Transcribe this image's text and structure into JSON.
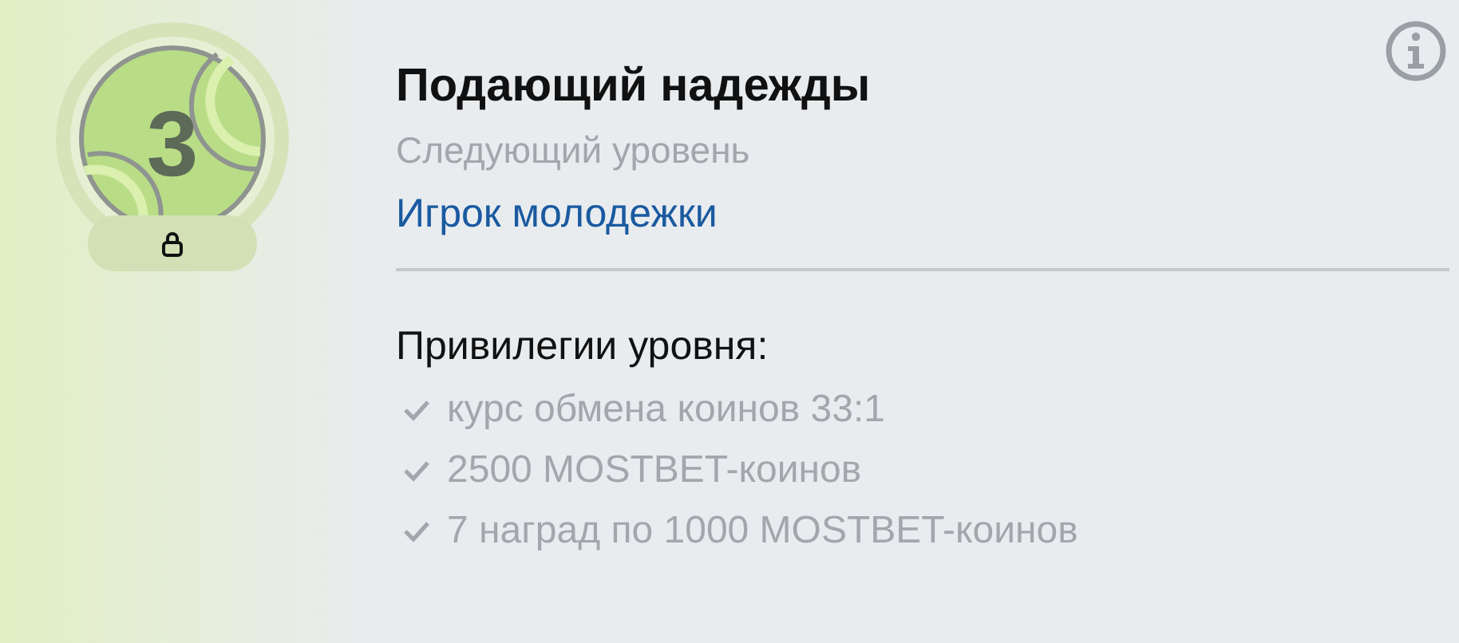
{
  "badge": {
    "number": "3",
    "locked": true
  },
  "level": {
    "title": "Подающий надежды",
    "next_label": "Следующий уровень",
    "next_link": "Игрок молодежки"
  },
  "privileges": {
    "heading": "Привилегии уровня:",
    "items": [
      {
        "text": "курс обмена коинов 33:1",
        "checked": true
      },
      {
        "text": "2500 MOSTBET-коинов",
        "checked": true
      },
      {
        "text": "7 наград по 1000 MOSTBET-коинов",
        "checked": true
      }
    ]
  }
}
